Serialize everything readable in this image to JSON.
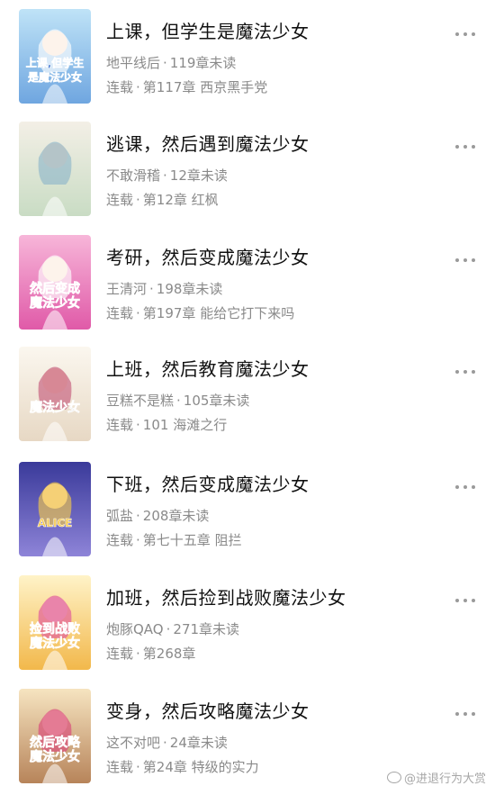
{
  "books": [
    {
      "title": "上课，但学生是魔法少女",
      "author": "地平线后",
      "unread": "119章未读",
      "status": "连载",
      "latest_chapter": "第117章 西京黑手党",
      "cover": {
        "bg1": "#bfe3f7",
        "bg2": "#6fa6e0",
        "accent": "#ffffff",
        "text": "上课,但学生\n是魔法少女",
        "text_color": "#2a63c9"
      }
    },
    {
      "title": "逃课，然后遇到魔法少女",
      "author": "不敢滑稽",
      "unread": "12章未读",
      "status": "连载",
      "latest_chapter": "第12章 红枫",
      "cover": {
        "bg1": "#f3efe6",
        "bg2": "#c9dcc4",
        "accent": "#8fb7c9",
        "text": "",
        "text_color": "#5b7f8e"
      }
    },
    {
      "title": "考研，然后变成魔法少女",
      "author": "王清河",
      "unread": "198章未读",
      "status": "连载",
      "latest_chapter": "第197章 能给它打下来吗",
      "cover": {
        "bg1": "#f7b6d9",
        "bg2": "#e05aa8",
        "accent": "#ffffff",
        "text": "然后变成\n魔法少女",
        "text_color": "#ffffff"
      }
    },
    {
      "title": "上班，然后教育魔法少女",
      "author": "豆糕不是糕",
      "unread": "105章未读",
      "status": "连载",
      "latest_chapter": "101 海滩之行",
      "cover": {
        "bg1": "#fbf7ef",
        "bg2": "#e7d8c4",
        "accent": "#c45a7b",
        "text": "魔法少女",
        "text_color": "#333333"
      }
    },
    {
      "title": "下班，然后变成魔法少女",
      "author": "弧盐",
      "unread": "208章未读",
      "status": "连载",
      "latest_chapter": "第七十五章 阻拦",
      "cover": {
        "bg1": "#3a3a9a",
        "bg2": "#8e84d8",
        "accent": "#f2c94c",
        "text": "ALICE",
        "text_color": "#f5c542"
      }
    },
    {
      "title": "加班，然后捡到战败魔法少女",
      "author": "炮豚QAQ",
      "unread": "271章未读",
      "status": "连载",
      "latest_chapter": "第268章",
      "cover": {
        "bg1": "#fff3c8",
        "bg2": "#f2b84b",
        "accent": "#e0549b",
        "text": "捡到战败\n魔法少女",
        "text_color": "#e0549b"
      }
    },
    {
      "title": "变身，然后攻略魔法少女",
      "author": "这不对吧",
      "unread": "24章未读",
      "status": "连载",
      "latest_chapter": "第24章 特级的实力",
      "cover": {
        "bg1": "#f6e4c0",
        "bg2": "#b7845a",
        "accent": "#d9477a",
        "text": "然后攻略\n魔法少女",
        "text_color": "#d9477a"
      }
    }
  ],
  "separator": "·",
  "watermark": "@进退行为大赏"
}
